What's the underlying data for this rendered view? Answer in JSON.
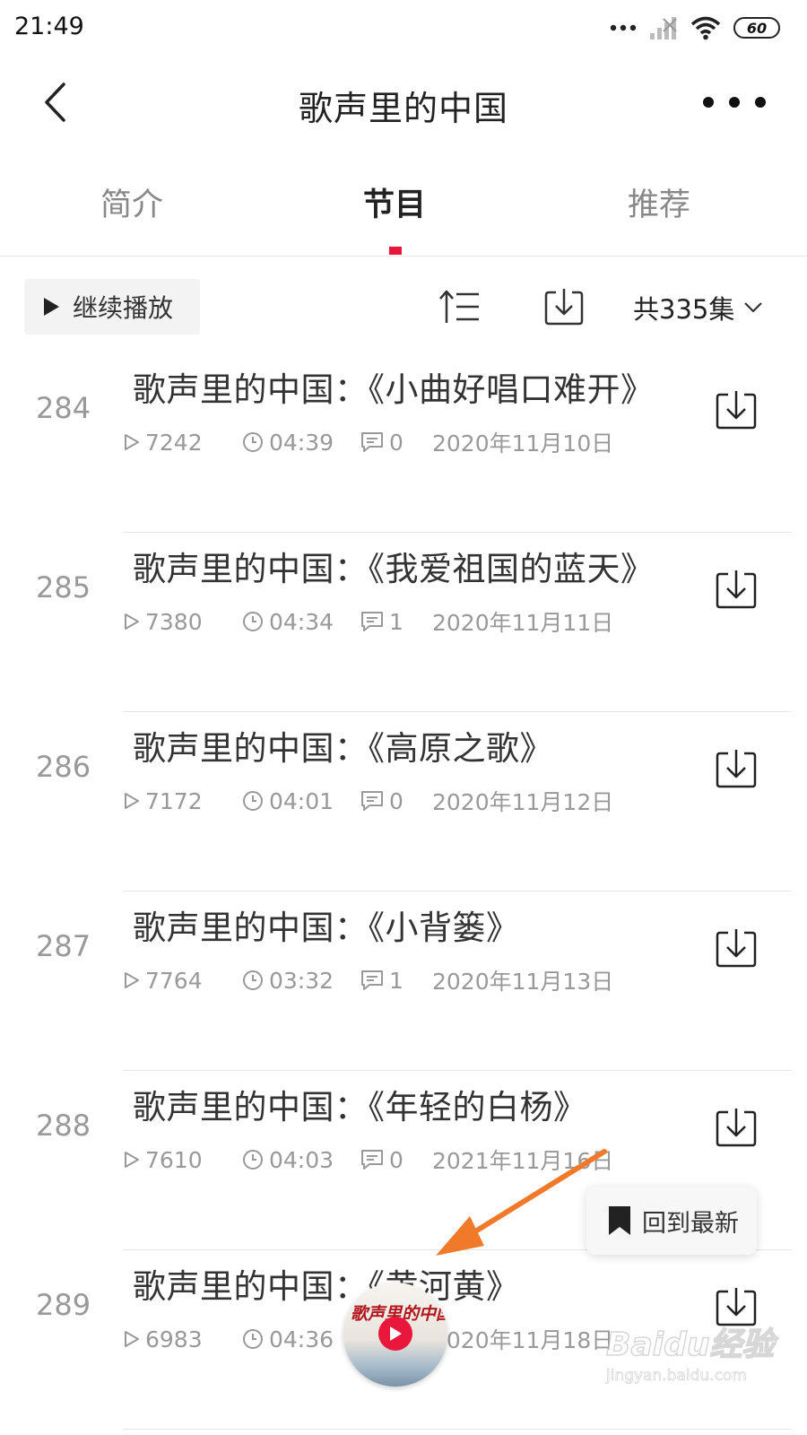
{
  "status_bar": {
    "time": "21:49",
    "battery": "60",
    "icons": [
      "dots-icon",
      "signal-icon",
      "wifi-icon",
      "battery-icon"
    ]
  },
  "nav": {
    "title": "歌声里的中国",
    "back_icon": "back-arrow-icon",
    "more_icon": "more-icon"
  },
  "tabs": [
    {
      "label": "简介",
      "active": false
    },
    {
      "label": "节目",
      "active": true
    },
    {
      "label": "推荐",
      "active": false
    }
  ],
  "toolbar": {
    "continue_label": "继续播放",
    "sort_icon": "sort-icon",
    "download_icon": "download-icon",
    "episode_count": "共335集"
  },
  "episodes": [
    {
      "num": "284",
      "title": "歌声里的中国：《小曲好唱口难开》",
      "plays": "7242",
      "duration": "04:39",
      "comments": "0",
      "date": "2020年11月10日"
    },
    {
      "num": "285",
      "title": "歌声里的中国：《我爱祖国的蓝天》",
      "plays": "7380",
      "duration": "04:34",
      "comments": "1",
      "date": "2020年11月11日"
    },
    {
      "num": "286",
      "title": "歌声里的中国：《高原之歌》",
      "plays": "7172",
      "duration": "04:01",
      "comments": "0",
      "date": "2020年11月12日"
    },
    {
      "num": "287",
      "title": "歌声里的中国：《小背篓》",
      "plays": "7764",
      "duration": "03:32",
      "comments": "1",
      "date": "2020年11月13日"
    },
    {
      "num": "288",
      "title": "歌声里的中国：《年轻的白杨》",
      "plays": "7610",
      "duration": "04:03",
      "comments": "0",
      "date": "2021年11月16日"
    },
    {
      "num": "289",
      "title": "歌声里的中国：《黄河黄》",
      "plays": "6983",
      "duration": "04:36",
      "comments": "",
      "date": "2020年11月18日"
    }
  ],
  "floating": {
    "back_to_latest": "回到最新",
    "mini_player_title": "歌声里的中国"
  },
  "watermark": {
    "logo": "Baidu经验",
    "url": "jingyan.baidu.com"
  },
  "colors": {
    "accent": "#e8173b",
    "annotation_arrow": "#f07a2a"
  }
}
